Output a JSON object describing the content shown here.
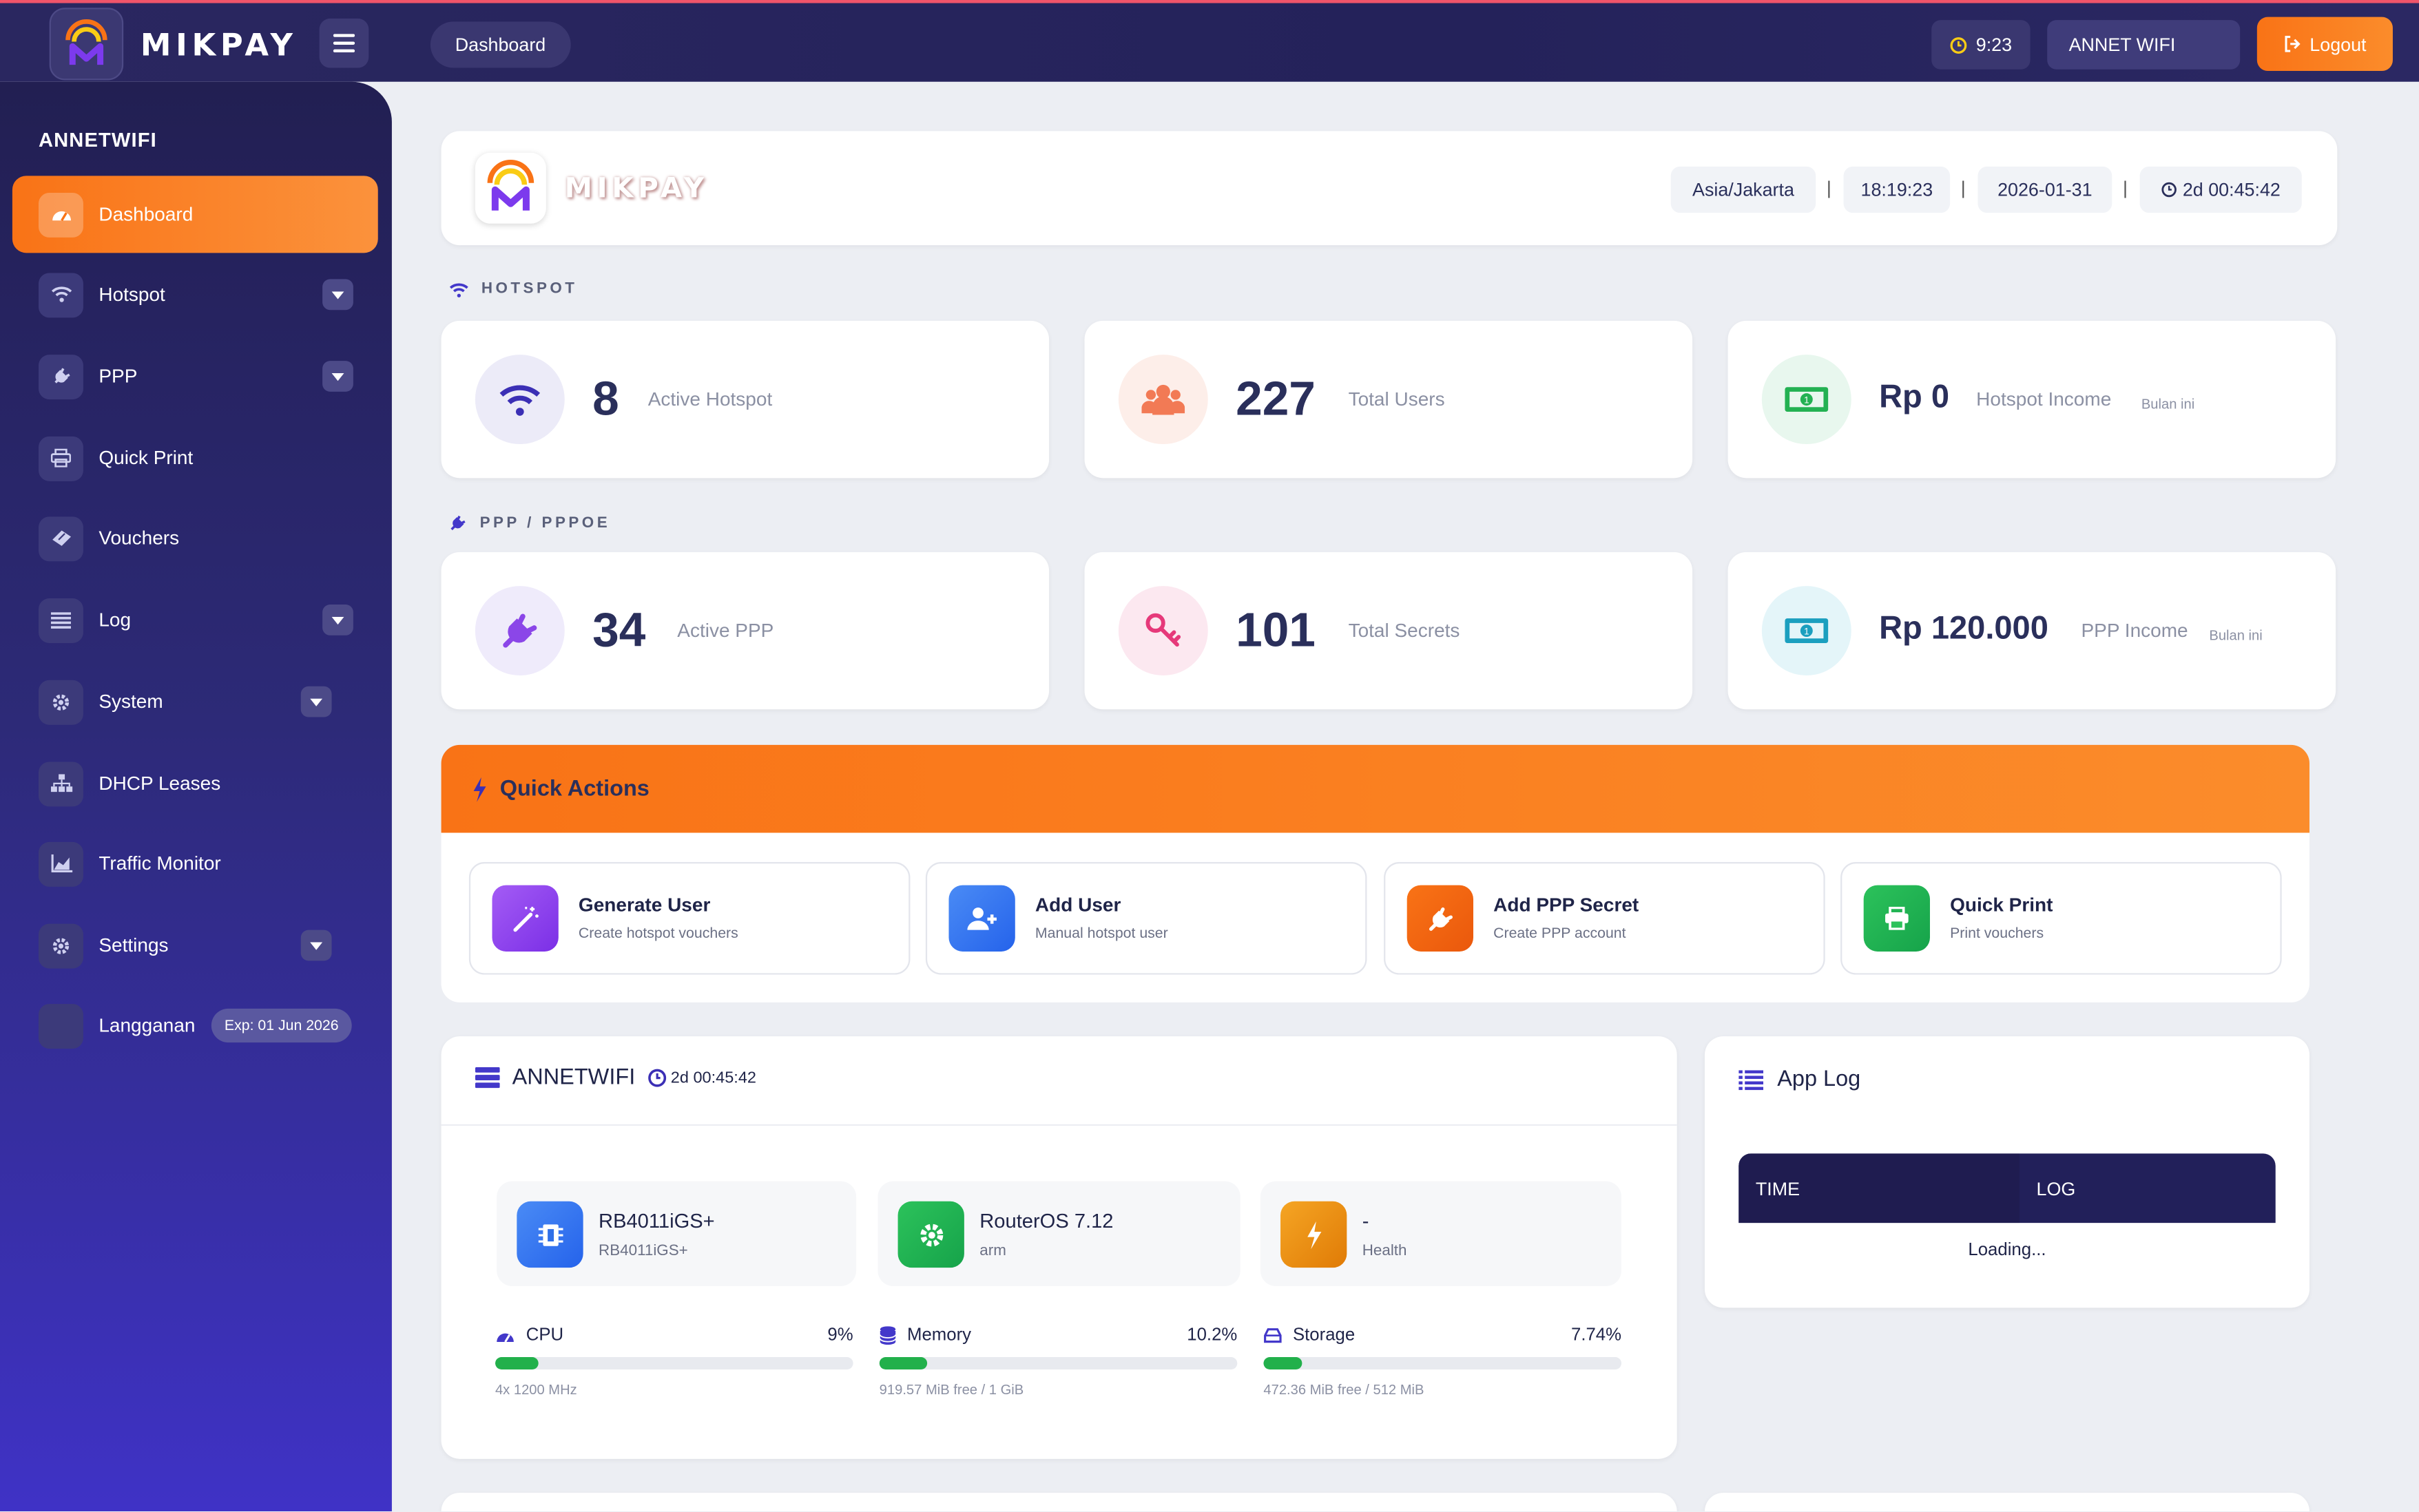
{
  "app": {
    "brand": "MIKPAY"
  },
  "topbar": {
    "breadcrumb": "Dashboard",
    "time": "9:23",
    "router_name": "ANNET WIFI",
    "logout_label": "Logout"
  },
  "sidebar": {
    "title": "ANNETWIFI",
    "items": [
      {
        "label": "Dashboard",
        "icon": "dashboard-icon",
        "active": true,
        "has_caret": false
      },
      {
        "label": "Hotspot",
        "icon": "wifi-icon",
        "has_caret": true
      },
      {
        "label": "PPP",
        "icon": "plug-icon",
        "has_caret": true
      },
      {
        "label": "Quick Print",
        "icon": "printer-icon",
        "has_caret": false
      },
      {
        "label": "Vouchers",
        "icon": "ticket-icon",
        "has_caret": false
      },
      {
        "label": "Log",
        "icon": "list-icon",
        "has_caret": true
      },
      {
        "label": "System",
        "icon": "gear-icon",
        "has_caret": true
      },
      {
        "label": "DHCP Leases",
        "icon": "network-icon",
        "has_caret": false
      },
      {
        "label": "Traffic Monitor",
        "icon": "chart-icon",
        "has_caret": false
      },
      {
        "label": "Settings",
        "icon": "gear-icon",
        "has_caret": true
      },
      {
        "label": "Langganan",
        "icon": "subscription-icon",
        "badge": "Exp: 01 Jun 2026"
      }
    ]
  },
  "header": {
    "timezone": "Asia/Jakarta",
    "clock": "18:19:23",
    "date": "2026-01-31",
    "uptime": "2d 00:45:42"
  },
  "hotspot": {
    "section_label": "HOTSPOT",
    "stats": [
      {
        "value": "8",
        "label": "Active Hotspot",
        "icon": "wifi-icon"
      },
      {
        "value": "227",
        "label": "Total Users",
        "icon": "users-icon"
      },
      {
        "value": "Rp 0",
        "label": "Hotspot Income",
        "sub": "Bulan ini",
        "icon": "money-icon"
      }
    ]
  },
  "ppp": {
    "section_label": "PPP / PPPOE",
    "stats": [
      {
        "value": "34",
        "label": "Active PPP",
        "icon": "plug-icon"
      },
      {
        "value": "101",
        "label": "Total Secrets",
        "icon": "key-icon"
      },
      {
        "value": "Rp 120.000",
        "label": "PPP Income",
        "sub": "Bulan ini",
        "icon": "money-icon"
      }
    ]
  },
  "quick_actions": {
    "title": "Quick Actions",
    "items": [
      {
        "title": "Generate User",
        "subtitle": "Create hotspot vouchers",
        "icon": "magic-wand-icon",
        "color": "#8b3bf0"
      },
      {
        "title": "Add User",
        "subtitle": "Manual hotspot user",
        "icon": "user-plus-icon",
        "color": "#2f6fe8"
      },
      {
        "title": "Add PPP Secret",
        "subtitle": "Create PPP account",
        "icon": "plug-icon",
        "color": "#f06a18"
      },
      {
        "title": "Quick Print",
        "subtitle": "Print vouchers",
        "icon": "printer-icon",
        "color": "#1fae4c"
      }
    ]
  },
  "system": {
    "title": "ANNETWIFI",
    "uptime": "2d 00:45:42",
    "tiles": [
      {
        "title": "RB4011iGS+",
        "subtitle": "RB4011iGS+",
        "icon": "chip-icon",
        "color": "#2f6fe8"
      },
      {
        "title": "RouterOS 7.12",
        "subtitle": "arm",
        "icon": "gear-icon",
        "color": "#1fae4c"
      },
      {
        "title": "-",
        "subtitle": "Health",
        "icon": "bolt-icon",
        "color": "#f08a0c"
      }
    ],
    "meters": [
      {
        "label": "CPU",
        "value": "9%",
        "fraction": 0.09,
        "detail": "4x 1200 MHz",
        "icon": "cpu-icon"
      },
      {
        "label": "Memory",
        "value": "10.2%",
        "fraction": 0.102,
        "detail": "919.57 MiB free / 1 GiB",
        "icon": "memory-icon"
      },
      {
        "label": "Storage",
        "value": "7.74%",
        "fraction": 0.0774,
        "detail": "472.36 MiB free / 512 MiB",
        "icon": "storage-icon"
      }
    ]
  },
  "app_log": {
    "title": "App Log",
    "columns": [
      "TIME",
      "LOG"
    ],
    "status": "Loading..."
  }
}
